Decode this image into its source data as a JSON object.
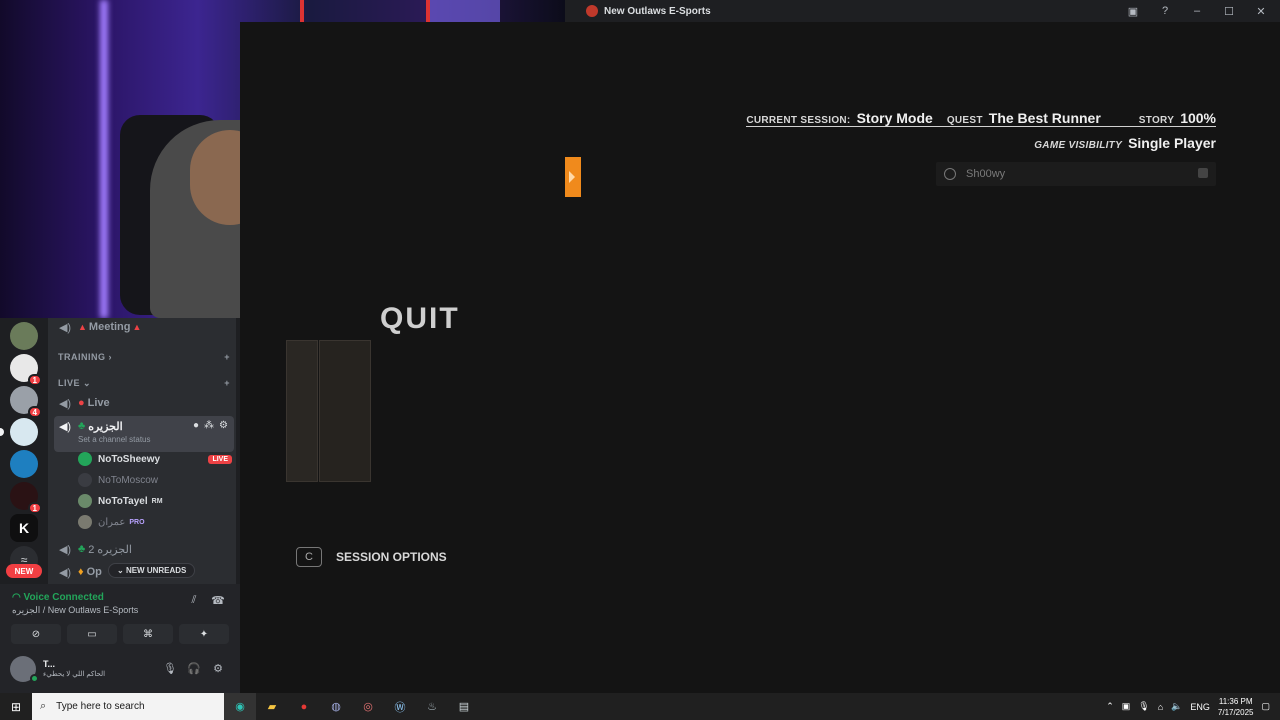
{
  "window": {
    "title": "New Outlaws E-Sports"
  },
  "game": {
    "current_session_label": "CURRENT SESSION:",
    "current_session_value": "Story Mode",
    "quest_label": "QUEST",
    "quest_value": "The Best Runner",
    "story_label": "STORY",
    "story_value": "100%",
    "visibility_label": "GAME VISIBILITY",
    "visibility_value": "Single Player",
    "player_name": "Sh00wy",
    "quit_label": "QUIT",
    "session_options_key": "C",
    "session_options_label": "SESSION OPTIONS"
  },
  "rail": {
    "badges": [
      "1",
      "4",
      "1"
    ],
    "new_label": "NEW"
  },
  "channels": {
    "meeting": "Meeting",
    "training_category": "TRAINING",
    "live_category": "LIVE",
    "live_channel": "Live",
    "active_channel": "الجزيره",
    "active_status": "Set a channel status",
    "users": [
      {
        "name": "NoToSheewy",
        "badge": "LIVE"
      },
      {
        "name": "NoToMoscow",
        "badge": ""
      },
      {
        "name": "NoToTayel",
        "badge": "RM"
      },
      {
        "name": "عمران",
        "badge": "PRO"
      }
    ],
    "channel_2": "الجزيره 2",
    "channel_3": "Op",
    "new_unreads": "NEW UNREADS"
  },
  "voice": {
    "status": "Voice Connected",
    "location": "الجزيره / New Outlaws E-Sports"
  },
  "user": {
    "name": "T...",
    "status": "الحاكم اللي لا يحطيء"
  },
  "taskbar": {
    "search_placeholder": "Type here to search",
    "language": "ENG",
    "time": "11:36 PM",
    "date": "7/17/2025"
  }
}
